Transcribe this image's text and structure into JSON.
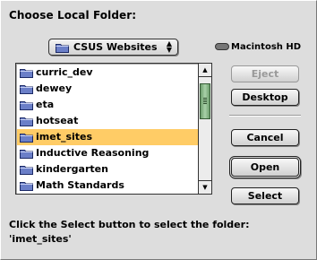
{
  "dialog": {
    "title": "Choose Local Folder:",
    "location_popup": {
      "value": "CSUS Websites",
      "icon": "folder-icon"
    },
    "volume": {
      "label": "Macintosh HD",
      "icon": "hard-drive-icon"
    }
  },
  "folders": [
    {
      "name": "curric_dev",
      "selected": false
    },
    {
      "name": "dewey",
      "selected": false
    },
    {
      "name": "eta",
      "selected": false
    },
    {
      "name": "hotseat",
      "selected": false
    },
    {
      "name": "imet_sites",
      "selected": true
    },
    {
      "name": "Inductive Reasoning",
      "selected": false
    },
    {
      "name": "kindergarten",
      "selected": false
    },
    {
      "name": "Math Standards",
      "selected": false
    }
  ],
  "buttons": {
    "eject": "Eject",
    "desktop": "Desktop",
    "cancel": "Cancel",
    "open": "Open",
    "select": "Select"
  },
  "hint": {
    "line1": "Click the Select button to select the folder:",
    "line2": "'imet_sites'"
  },
  "colors": {
    "selection": "#ffcc66",
    "scroll_thumb": "#8fbf8f",
    "folder_blue": "#6b7fc8"
  }
}
